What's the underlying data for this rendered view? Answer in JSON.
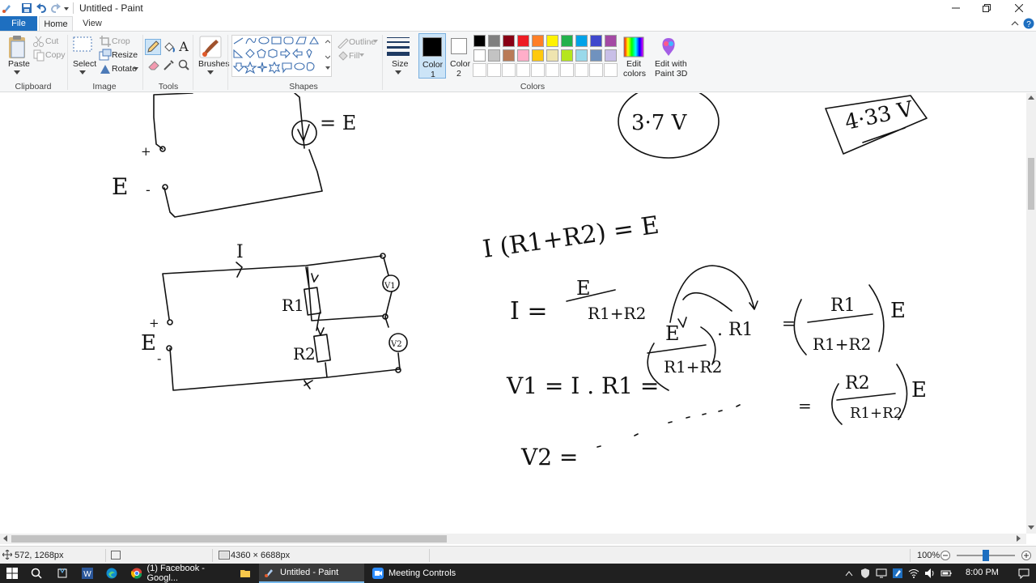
{
  "window": {
    "title": "Untitled - Paint"
  },
  "tabs": {
    "file": "File",
    "home": "Home",
    "view": "View"
  },
  "clipboard": {
    "paste": "Paste",
    "cut": "Cut",
    "copy": "Copy",
    "group": "Clipboard"
  },
  "image": {
    "select": "Select",
    "crop": "Crop",
    "resize": "Resize",
    "rotate": "Rotate",
    "group": "Image"
  },
  "tools": {
    "group": "Tools"
  },
  "brushes": {
    "label": "Brushes"
  },
  "shapes": {
    "group": "Shapes",
    "outline": "Outline",
    "fill": "Fill"
  },
  "size": {
    "label": "Size"
  },
  "colors": {
    "color1": "Color\n1",
    "color1_a": "Color",
    "color1_b": "1",
    "color2_a": "Color",
    "color2_b": "2",
    "edit_a": "Edit",
    "edit_b": "colors",
    "p3d_a": "Edit with",
    "p3d_b": "Paint 3D",
    "group": "Colors",
    "palette_row1": [
      "#000000",
      "#7f7f7f",
      "#880015",
      "#ed1c24",
      "#ff7f27",
      "#fff200",
      "#22b14c",
      "#00a2e8",
      "#3f48cc",
      "#a349a4"
    ],
    "palette_row2": [
      "#ffffff",
      "#c3c3c3",
      "#b97a57",
      "#ffaec9",
      "#ffc90e",
      "#efe4b0",
      "#b5e61d",
      "#99d9ea",
      "#7092be",
      "#c8bfe7"
    ]
  },
  "canvas_notes": {
    "e_label": "E",
    "plus": "+",
    "minus": "-",
    "eq_e": "= E",
    "v1_circle": "3·7 V",
    "v2_box": "4·33 V",
    "i_label": "I",
    "r1": "R1",
    "r2": "R2",
    "v1": "V1",
    "v2": "V2",
    "eq1": "I (R1+R2) = E",
    "eq2_lhs": "I =",
    "eq2_num": "E",
    "eq2_den": "R1+R2",
    "eq3_lhs": "V1 = I . R1 =",
    "eq3_num": "E",
    "eq3_den": "R1+R2",
    "eq3_tail": ". R1",
    "eq3_rhs_num": "R1",
    "eq3_rhs_den": "R1+R2",
    "eq3_rhs_e": "E",
    "eq4_lhs": "V2 =",
    "eq4_rhs_num": "R2",
    "eq4_rhs_den": "R1+R2",
    "eq4_rhs_e": "E"
  },
  "statusbar": {
    "cursor": "572, 1268px",
    "dimensions": "4360 × 6688px",
    "zoom": "100%",
    "zoom_level": 0.5
  },
  "taskbar": {
    "chrome": "(1) Facebook - Googl...",
    "paint": "Untitled - Paint",
    "zoom": "Meeting Controls",
    "time": "8:00 PM"
  }
}
